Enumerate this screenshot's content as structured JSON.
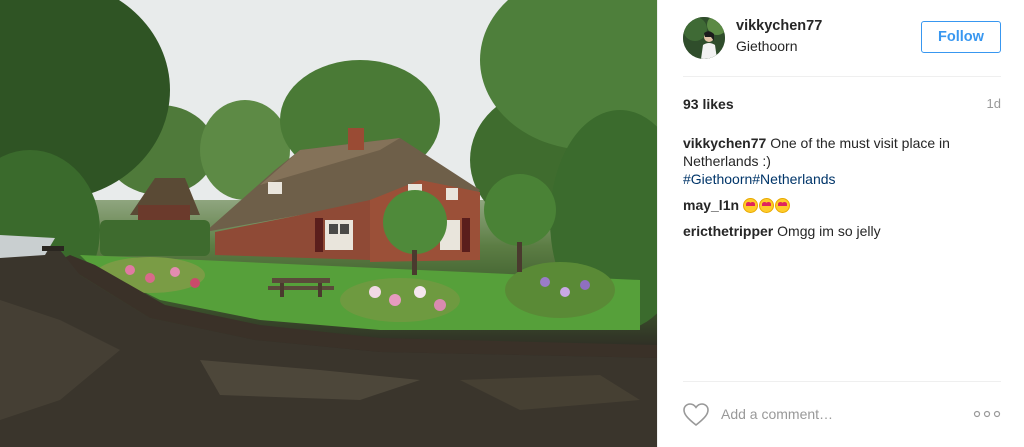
{
  "post": {
    "username": "vikkychen77",
    "location": "Giethoorn",
    "follow_label": "Follow",
    "likes": "93 likes",
    "time": "1d"
  },
  "comments": [
    {
      "user": "vikkychen77",
      "text": "One of the must visit place in Netherlands :)",
      "hashtags": "#Giethoorn#Netherlands"
    },
    {
      "user": "may_l1n",
      "emoji_count": 3
    },
    {
      "user": "ericthetripper",
      "text": "Omgg im so jelly"
    }
  ],
  "footer": {
    "comment_placeholder": "Add a comment…",
    "icons": [
      "heart-icon",
      "more-options-icon"
    ]
  },
  "colors": {
    "accent": "#3897f0",
    "hashtag": "#003569",
    "muted": "#999999",
    "text": "#262626"
  }
}
